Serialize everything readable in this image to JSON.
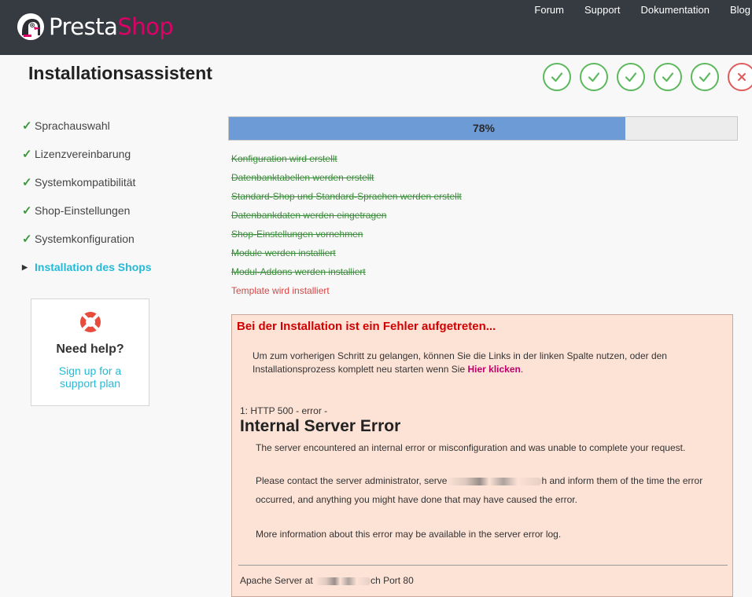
{
  "header": {
    "logo_part1": "Presta",
    "logo_part2": "Shop",
    "nav": [
      "Forum",
      "Support",
      "Dokumentation",
      "Blog"
    ]
  },
  "page_title": "Installationsassistent",
  "steps": [
    {
      "status": "done",
      "icon": "check-icon"
    },
    {
      "status": "done",
      "icon": "check-icon"
    },
    {
      "status": "done",
      "icon": "check-icon"
    },
    {
      "status": "done",
      "icon": "check-icon"
    },
    {
      "status": "done",
      "icon": "check-icon"
    },
    {
      "status": "error",
      "icon": "close-icon"
    }
  ],
  "sidebar": {
    "items": [
      {
        "label": "Sprachauswahl",
        "state": "done"
      },
      {
        "label": "Lizenzvereinbarung",
        "state": "done"
      },
      {
        "label": "Systemkompatibilität",
        "state": "done"
      },
      {
        "label": "Shop-Einstellungen",
        "state": "done"
      },
      {
        "label": "Systemkonfiguration",
        "state": "done"
      },
      {
        "label": "Installation des Shops",
        "state": "active"
      }
    ],
    "check_glyph": "✓",
    "arrow_glyph": "▶"
  },
  "help": {
    "title": "Need help?",
    "link": "Sign up for a support plan"
  },
  "progress": {
    "value": 0.78,
    "label": "78%"
  },
  "tasks": [
    {
      "label": "Konfiguration wird erstellt",
      "state": "done"
    },
    {
      "label": "Datenbanktabellen werden erstellt",
      "state": "done"
    },
    {
      "label": "Standard-Shop und Standard-Sprachen werden erstellt",
      "state": "done"
    },
    {
      "label": "Datenbankdaten werden eingetragen",
      "state": "done"
    },
    {
      "label": "Shop-Einstellungen vornehmen",
      "state": "done"
    },
    {
      "label": "Module werden installiert",
      "state": "done"
    },
    {
      "label": "Modul-Addons werden installiert",
      "state": "done"
    },
    {
      "label": "Template wird installiert",
      "state": "current"
    }
  ],
  "error": {
    "title": "Bei der Installation ist ein Fehler aufgetreten...",
    "desc_before": "Um zum vorherigen Schritt zu gelangen, können Sie die Links in der linken Spalte nutzen, oder den Installationsprozess komplett neu starten wenn Sie ",
    "desc_link": "Hier klicken",
    "desc_after": ".",
    "code": "1: HTTP 500 - error -",
    "heading": "Internal Server Error",
    "p1": "The server encountered an internal error or misconfiguration and was unable to complete your request.",
    "p2_before": "Please contact the server administrator, serve",
    "p2_after": "h and inform them of the time the error occurred, and anything you might have done that may have caused the error.",
    "p3": "More information about this error may be available in the server error log.",
    "footer_before": "Apache Server at ",
    "footer_after": "ch Port 80"
  },
  "colors": {
    "header_bg": "#363a41",
    "brand_pink": "#df0067",
    "accent_cyan": "#25b9d7",
    "success_green": "#5cb85c",
    "error_red": "#e05a5a",
    "progress_blue": "#6c9bd6",
    "error_box_bg": "#fde2d6"
  }
}
